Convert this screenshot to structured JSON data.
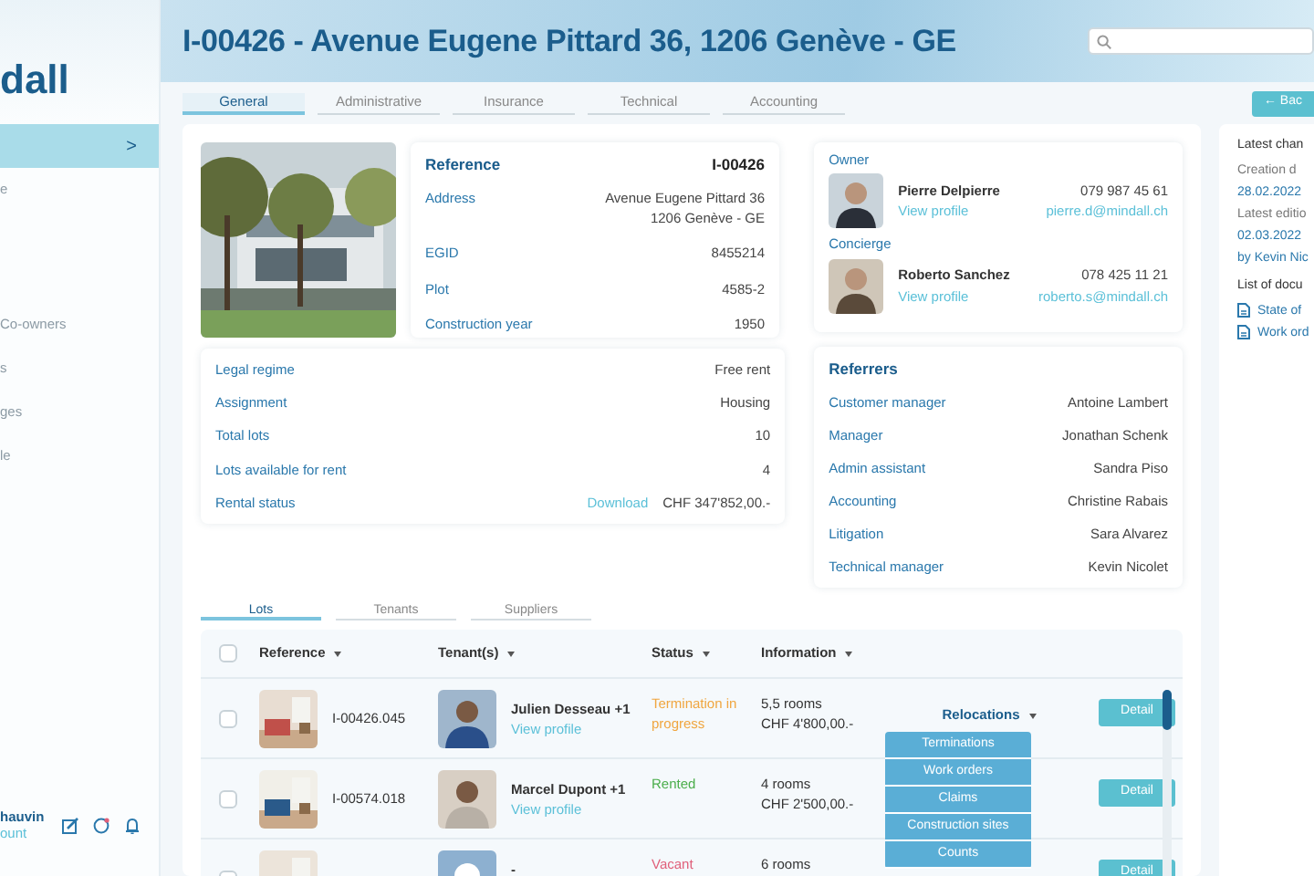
{
  "sidebar": {
    "logo": "dall",
    "nav_groups": [
      [
        {
          "chevron": ">",
          "selected": true
        },
        {
          "label": "e",
          "selected": false
        }
      ],
      [
        {
          "label": "Co-owners",
          "selected": false
        },
        {
          "label": "s",
          "selected": false
        },
        {
          "label": "ges",
          "selected": false
        },
        {
          "label": "le",
          "selected": false
        }
      ]
    ],
    "user": {
      "name": "hauvin",
      "link": "ount"
    }
  },
  "header": {
    "title": "I-00426 - Avenue Eugene Pittard 36, 1206 Genève - GE"
  },
  "tabs": [
    {
      "label": "General",
      "selected": true
    },
    {
      "label": "Administrative",
      "selected": false
    },
    {
      "label": "Insurance",
      "selected": false
    },
    {
      "label": "Technical",
      "selected": false
    },
    {
      "label": "Accounting",
      "selected": false
    }
  ],
  "back_button": "← Bac",
  "building": {
    "title": "Reference",
    "reference": "I-00426",
    "fields": [
      {
        "label": "Address",
        "lines": [
          "Avenue Eugene Pittard 36",
          "1206 Genève - GE"
        ]
      },
      {
        "label": "EGID",
        "lines": [
          "8455214"
        ]
      },
      {
        "label": "Plot",
        "lines": [
          "4585-2"
        ]
      },
      {
        "label": "Construction year",
        "lines": [
          "1950"
        ]
      }
    ]
  },
  "details": [
    {
      "label": "Legal regime",
      "value": "Free rent"
    },
    {
      "label": "Assignment",
      "value": "Housing"
    },
    {
      "label": "Total lots",
      "value": "10"
    },
    {
      "label": "Lots available for rent",
      "value": "4"
    },
    {
      "label": "Rental status",
      "link": "Download",
      "value": "CHF 347'852,00.-"
    }
  ],
  "contacts": [
    {
      "role": "Owner",
      "name": "Pierre Delpierre",
      "link": "View profile",
      "phone": "079 987 45 61",
      "email": "pierre.d@mindall.ch"
    },
    {
      "role": "Concierge",
      "name": "Roberto Sanchez",
      "link": "View profile",
      "phone": "078 425 11 21",
      "email": "roberto.s@mindall.ch"
    }
  ],
  "referrers": {
    "title": "Referrers",
    "rows": [
      {
        "label": "Customer manager",
        "value": "Antoine Lambert"
      },
      {
        "label": "Manager",
        "value": "Jonathan Schenk"
      },
      {
        "label": "Admin assistant",
        "value": "Sandra Piso"
      },
      {
        "label": "Accounting",
        "value": "Christine Rabais"
      },
      {
        "label": "Litigation",
        "value": "Sara Alvarez"
      },
      {
        "label": "Technical manager",
        "value": "Kevin Nicolet"
      }
    ]
  },
  "lot_tabs": [
    {
      "label": "Lots",
      "selected": true
    },
    {
      "label": "Tenants",
      "selected": false
    },
    {
      "label": "Suppliers",
      "selected": false
    }
  ],
  "table": {
    "all_checked": false,
    "columns": [
      "Reference",
      "Tenant(s)",
      "Status",
      "Information"
    ],
    "rows": [
      {
        "checked": false,
        "reference": "I-00426.045",
        "tenant": "Julien Desseau +1",
        "tenant_link": "View profile",
        "status": "Termination in progress",
        "color": "#f0a640",
        "info": [
          "5,5 rooms",
          "CHF 4'800,00.-"
        ],
        "action": "Relocations",
        "button": "Detail"
      },
      {
        "checked": false,
        "reference": "I-00574.018",
        "tenant": "Marcel Dupont +1",
        "tenant_link": "View profile",
        "status": "Rented",
        "color": "#4cae4c",
        "info": [
          "4 rooms",
          "CHF 2'500,00.-"
        ],
        "button": "Detail"
      },
      {
        "checked": false,
        "tenant": "-",
        "status": "Vacant",
        "color": "#e0607a",
        "info": [
          "6 rooms"
        ],
        "button": "Detail"
      }
    ]
  },
  "dropdown": [
    "Terminations",
    "Work orders",
    "Claims",
    "Construction sites",
    "Counts"
  ],
  "side_panel": {
    "title": "Latest chan",
    "rows": [
      {
        "label": "Creation d",
        "value": "28.02.2022"
      },
      {
        "label": "Latest editio",
        "value": "02.03.2022",
        "by": "by Kevin Nic"
      }
    ],
    "docs_title": "List of docu",
    "docs": [
      "State of",
      "Work ord"
    ]
  }
}
